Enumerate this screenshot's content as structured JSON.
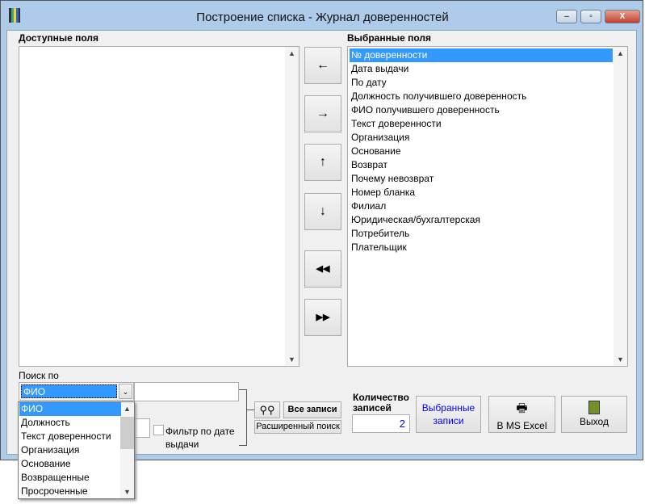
{
  "window": {
    "title": "Построение списка - Журнал доверенностей",
    "minimize": "–",
    "maximize": "▫",
    "close": "X"
  },
  "available": {
    "label": "Доступные поля",
    "items": []
  },
  "selected": {
    "label": "Выбранные поля",
    "items": [
      "№ доверенности",
      "Дата выдачи",
      "По дату",
      "Должность получившего доверенность",
      "ФИО получившего доверенность",
      "Текст доверенности",
      "Организация",
      "Основание",
      "Возврат",
      "Почему невозврат",
      "Номер бланка",
      "Филиал",
      "Юридическая/бухгалтерская",
      "Потребитель",
      "Плательщик"
    ]
  },
  "move_buttons": [
    "←",
    "→",
    "↑",
    "↓",
    "◀◀",
    "▶▶"
  ],
  "search": {
    "label": "Поиск по",
    "selected": "ФИО",
    "value": "",
    "options": [
      "ФИО",
      "Должность",
      "Текст доверенности",
      "Организация",
      "Основание",
      "Возвращенные",
      "Просроченные"
    ],
    "date_filter_label": "Фильтр по дате выдачи",
    "date_filter_checked": false,
    "find_icon": "binoculars-icon",
    "all_records": "Все записи",
    "advanced": "Расширенный поиск"
  },
  "count": {
    "label": "Количество записей",
    "value": "2"
  },
  "buttons": {
    "selected_records": "Выбранные записи",
    "excel": "В MS Excel",
    "exit": "Выход"
  },
  "colors": {
    "selection": "#3399ff",
    "link_text": "#0000ff"
  }
}
